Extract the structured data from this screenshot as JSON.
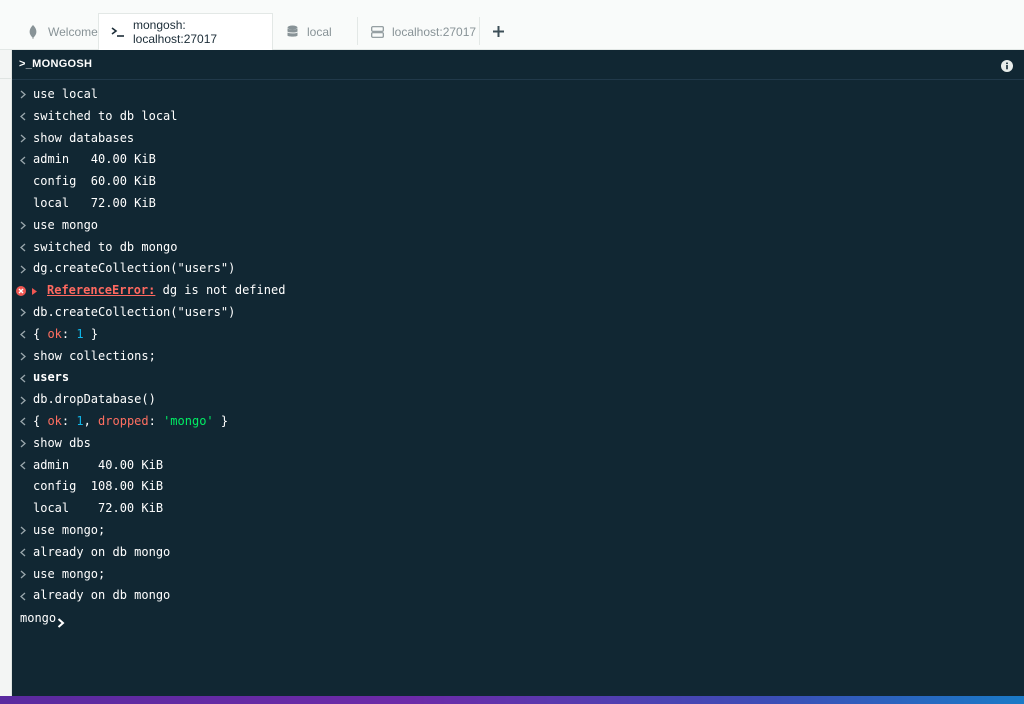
{
  "tabs": [
    {
      "label": "Welcome",
      "icon": "leaf-icon",
      "active": false
    },
    {
      "label": "mongosh: localhost:27017",
      "icon": "terminal-icon",
      "active": true
    },
    {
      "label": "local",
      "icon": "database-icon",
      "active": false
    },
    {
      "label": "localhost:27017",
      "icon": "server-icon",
      "active": false
    }
  ],
  "add_tab_icon": "plus-icon",
  "shell": {
    "title": ">_MONGOSH",
    "info_icon": "info-icon",
    "lines": [
      {
        "type": "input",
        "text": "use local"
      },
      {
        "type": "output",
        "text": "switched to db local"
      },
      {
        "type": "input",
        "text": "show databases"
      },
      {
        "type": "output",
        "text": "admin   40.00 KiB"
      },
      {
        "type": "output-cont",
        "text": "config  60.00 KiB"
      },
      {
        "type": "output-cont",
        "text": "local   72.00 KiB"
      },
      {
        "type": "input",
        "text": "use mongo"
      },
      {
        "type": "output",
        "text": "switched to db mongo"
      },
      {
        "type": "input",
        "text": "dg.createCollection(\"users\")"
      },
      {
        "type": "error",
        "name": "ReferenceError:",
        "text": " dg is not defined"
      },
      {
        "type": "input",
        "text": "db.createCollection(\"users\")"
      },
      {
        "type": "output-obj1",
        "p1": "{ ",
        "k1": "ok",
        "p2": ": ",
        "v1": "1",
        "p3": " }"
      },
      {
        "type": "input",
        "text": "show collections;"
      },
      {
        "type": "output-bold",
        "text": "users"
      },
      {
        "type": "input",
        "text": "db.dropDatabase()"
      },
      {
        "type": "output-obj2",
        "p1": "{ ",
        "k1": "ok",
        "p2": ": ",
        "v1": "1",
        "p3": ", ",
        "k2": "dropped",
        "p4": ": ",
        "v2": "'mongo'",
        "p5": " }"
      },
      {
        "type": "input",
        "text": "show dbs"
      },
      {
        "type": "output",
        "text": "admin    40.00 KiB"
      },
      {
        "type": "output-cont",
        "text": "config  108.00 KiB"
      },
      {
        "type": "output-cont",
        "text": "local    72.00 KiB"
      },
      {
        "type": "input",
        "text": "use mongo;"
      },
      {
        "type": "output",
        "text": "already on db mongo"
      },
      {
        "type": "input",
        "text": "use mongo;"
      },
      {
        "type": "output",
        "text": "already on db mongo"
      }
    ],
    "prompt": "mongo",
    "prompt_value": ""
  },
  "colors": {
    "shell_bg": "#112733",
    "key": "#ff6f61",
    "number": "#0fb7ea",
    "string": "#00ed64",
    "error": "#ff6960"
  }
}
